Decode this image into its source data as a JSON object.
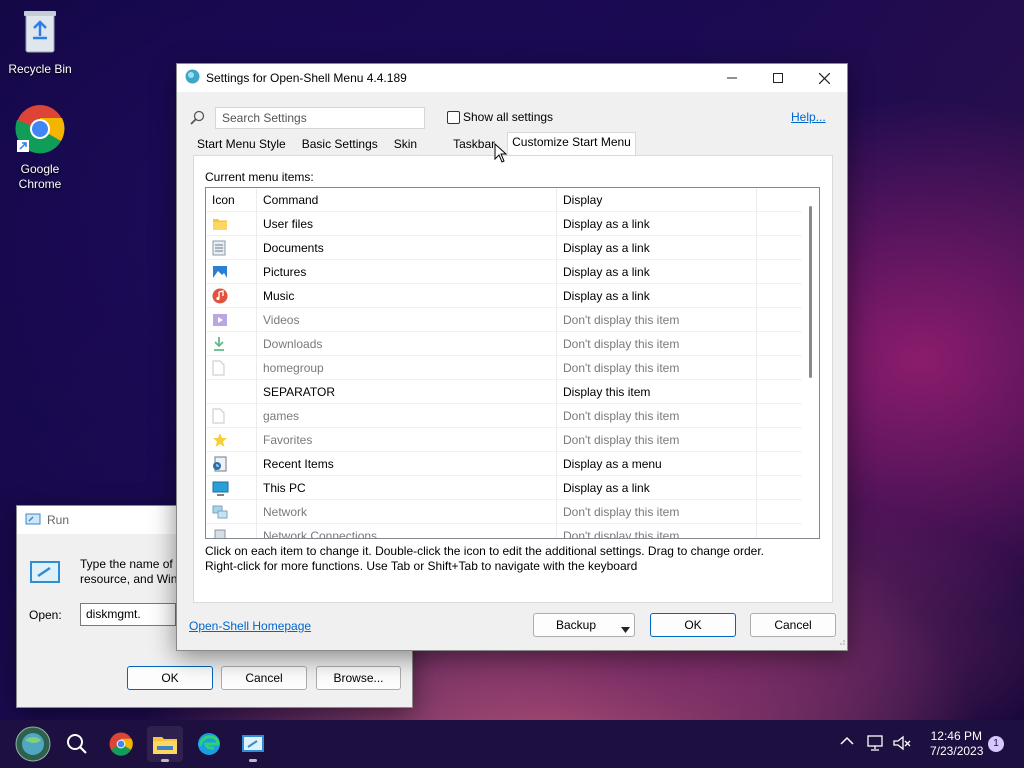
{
  "desktop": {
    "recycle_bin": "Recycle Bin",
    "chrome": "Google Chrome"
  },
  "run": {
    "title": "Run",
    "description": "Type the name of a program, folder, document, or Internet resource, and Windows will open it for you.",
    "desc_line1": "Type the name of a",
    "desc_line2": "resource, and Win",
    "open_label": "Open:",
    "open_value": "diskmgmt.",
    "ok": "OK",
    "cancel": "Cancel",
    "browse": "Browse..."
  },
  "settings": {
    "title": "Settings for Open-Shell Menu 4.4.189",
    "search_placeholder": "Search Settings",
    "show_all": "Show all settings",
    "help": "Help...",
    "tabs": [
      "Start Menu Style",
      "Basic Settings",
      "Skin",
      "Taskbar",
      "Customize Start Menu"
    ],
    "current_label": "Current menu items:",
    "columns": {
      "icon": "Icon",
      "command": "Command",
      "display": "Display"
    },
    "rows": [
      {
        "icon": "folder-icon",
        "command": "User files",
        "display": "Display as a link",
        "dim": false
      },
      {
        "icon": "document-icon",
        "command": "Documents",
        "display": "Display as a link",
        "dim": false
      },
      {
        "icon": "picture-icon",
        "command": "Pictures",
        "display": "Display as a link",
        "dim": false
      },
      {
        "icon": "music-icon",
        "command": "Music",
        "display": "Display as a link",
        "dim": false
      },
      {
        "icon": "video-icon",
        "command": "Videos",
        "display": "Don't display this item",
        "dim": true
      },
      {
        "icon": "download-icon",
        "command": "Downloads",
        "display": "Don't display this item",
        "dim": true
      },
      {
        "icon": "blank-file-icon",
        "command": "homegroup",
        "display": "Don't display this item",
        "dim": true
      },
      {
        "icon": "",
        "command": "SEPARATOR",
        "display": "Display this item",
        "dim": false
      },
      {
        "icon": "blank-file-icon",
        "command": "games",
        "display": "Don't display this item",
        "dim": true
      },
      {
        "icon": "star-icon",
        "command": "Favorites",
        "display": "Don't display this item",
        "dim": true
      },
      {
        "icon": "recent-items-icon",
        "command": "Recent Items",
        "display": "Display as a menu",
        "dim": false
      },
      {
        "icon": "monitor-icon",
        "command": "This PC",
        "display": "Display as a link",
        "dim": false
      },
      {
        "icon": "network-icon",
        "command": "Network",
        "display": "Don't display this item",
        "dim": true
      },
      {
        "icon": "network-connections-icon",
        "command": "Network Connections",
        "display": "Don't display this item",
        "dim": true
      }
    ],
    "hint_line1": "Click on each item to change it. Double-click the icon to edit the additional settings. Drag to change order.",
    "hint_line2": "Right-click for more functions. Use Tab or Shift+Tab to navigate with the keyboard",
    "homepage": "Open-Shell Homepage",
    "backup": "Backup",
    "ok": "OK",
    "cancel": "Cancel"
  },
  "taskbar": {
    "time": "12:46 PM",
    "date": "7/23/2023",
    "notification_count": "1"
  }
}
